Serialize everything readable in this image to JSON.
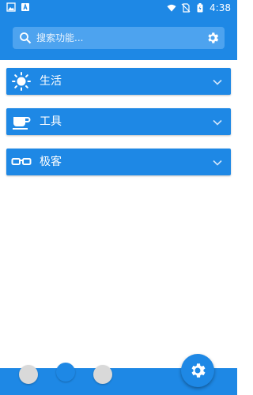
{
  "status_bar": {
    "time": "4:38",
    "left_icons": [
      "image-icon",
      "app-icon"
    ],
    "right_icons": [
      "wifi-icon",
      "no-sim-icon",
      "battery-icon"
    ]
  },
  "search": {
    "placeholder": "搜索功能...",
    "value": ""
  },
  "categories": [
    {
      "label": "生活",
      "icon": "sun-icon"
    },
    {
      "label": "工具",
      "icon": "cup-icon"
    },
    {
      "label": "极客",
      "icon": "glasses-icon"
    }
  ],
  "pager": {
    "total": 3,
    "active_index": 1
  },
  "colors": {
    "primary": "#1e88e5",
    "search_bg": "#4da3ef",
    "inactive_dot": "#d9d9d9"
  }
}
